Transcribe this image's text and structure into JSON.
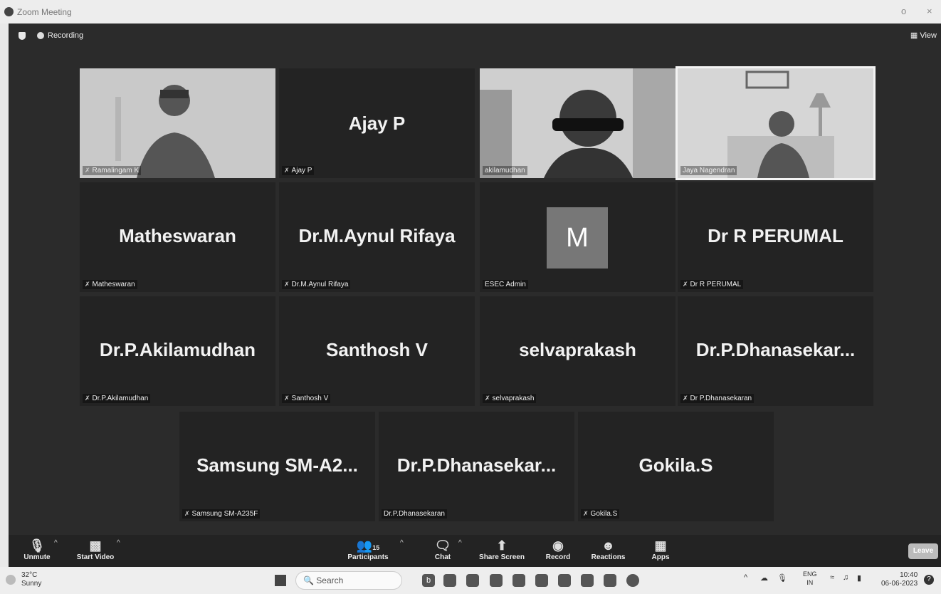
{
  "window": {
    "title": "Zoom Meeting",
    "min": "o",
    "close": "×"
  },
  "topbar": {
    "recording": "Recording",
    "view": "View"
  },
  "tiles": {
    "t1": {
      "label": "Ramalingam K"
    },
    "t2": {
      "name": "Ajay  P",
      "label": "Ajay  P"
    },
    "t3": {
      "label": "akilamudhan"
    },
    "t4": {
      "label": "Jaya Nagendran"
    },
    "t5": {
      "name": "Matheswaran",
      "label": "Matheswaran"
    },
    "t6": {
      "name": "Dr.M.Aynul Rifaya",
      "label": "Dr.M.Aynul Rifaya"
    },
    "t7": {
      "avatar": "M",
      "label": "ESEC Admin"
    },
    "t8": {
      "name": "Dr R PERUMAL",
      "label": "Dr R PERUMAL"
    },
    "t9": {
      "name": "Dr.P.Akilamudhan",
      "label": "Dr.P.Akilamudhan"
    },
    "t10": {
      "name": "Santhosh V",
      "label": "Santhosh V"
    },
    "t11": {
      "name": "selvaprakash",
      "label": "selvaprakash"
    },
    "t12": {
      "name": "Dr.P.Dhanasekar...",
      "label": "Dr P.Dhanasekaran"
    },
    "t13": {
      "name": "Samsung  SM-A2...",
      "label": "Samsung SM-A235F"
    },
    "t14": {
      "name": "Dr.P.Dhanasekar...",
      "label": "Dr.P.Dhanasekaran"
    },
    "t15": {
      "name": "Gokila.S",
      "label": "Gokila.S"
    }
  },
  "controls": {
    "unmute": "Unmute",
    "start_video": "Start Video",
    "participants": "Participants",
    "participant_count": "15",
    "chat": "Chat",
    "share": "Share Screen",
    "record": "Record",
    "reactions": "Reactions",
    "apps": "Apps",
    "leave": "Leave"
  },
  "taskbar": {
    "temp": "32°C",
    "weather": "Sunny",
    "search": "Search",
    "lang1": "ENG",
    "lang2": "IN",
    "time": "10:40",
    "date": "06-06-2023"
  },
  "icons": {
    "mic_muted": "mic-off-icon",
    "video_off": "video-off-icon",
    "participants": "people-icon",
    "chat": "chat-icon",
    "share": "share-screen-icon",
    "record": "record-icon",
    "reactions": "reaction-icon",
    "apps": "apps-icon"
  }
}
